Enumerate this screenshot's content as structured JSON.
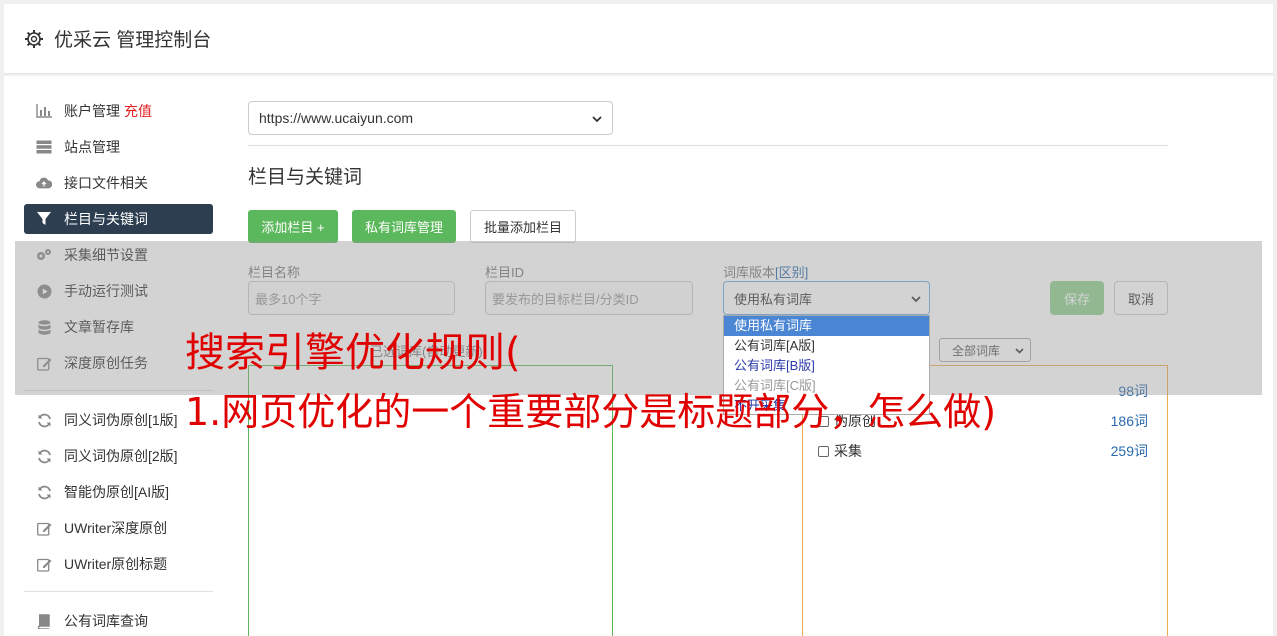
{
  "header": {
    "title": "优采云 管理控制台",
    "icon": "gear-icon"
  },
  "sidebar": {
    "items": [
      {
        "label": "账户管理",
        "icon": "bar-chart-icon",
        "badge": "充值"
      },
      {
        "label": "站点管理",
        "icon": "server-icon"
      },
      {
        "label": "接口文件相关",
        "icon": "cloud-upload-icon"
      },
      {
        "label": "栏目与关键词",
        "icon": "filter-icon",
        "active": true
      },
      {
        "label": "采集细节设置",
        "icon": "cogs-icon"
      },
      {
        "label": "手动运行测试",
        "icon": "play-circle-icon"
      },
      {
        "label": "文章暂存库",
        "icon": "database-icon"
      },
      {
        "label": "深度原创任务",
        "icon": "edit-icon"
      },
      {
        "label": "同义词伪原创[1版]",
        "icon": "refresh-icon"
      },
      {
        "label": "同义词伪原创[2版]",
        "icon": "refresh-icon"
      },
      {
        "label": "智能伪原创[AI版]",
        "icon": "refresh-icon"
      },
      {
        "label": "UWriter深度原创",
        "icon": "edit-icon"
      },
      {
        "label": "UWriter原创标题",
        "icon": "edit-icon"
      },
      {
        "label": "公有词库查询",
        "icon": "book-icon"
      }
    ]
  },
  "main": {
    "site_select": "https://www.ucaiyun.com",
    "section_title": "栏目与关键词",
    "buttons": {
      "add_column": "添加栏目 +",
      "private_lib": "私有词库管理",
      "batch_add": "批量添加栏目"
    },
    "form": {
      "name_label": "栏目名称",
      "name_placeholder": "最多10个字",
      "id_label": "栏目ID",
      "id_placeholder": "要发布的目标栏目/分类ID",
      "version_label": "词库版本",
      "version_link": "[区别]",
      "version_value": "使用私有词库",
      "save": "保存",
      "cancel": "取消"
    },
    "dropdown_options": [
      "使用私有词库",
      "公有词库[A版]",
      "公有词库[B版]",
      "公有词库[C版]",
      "不开采集"
    ],
    "box_caption": "已选词库(自动更新)",
    "lib_filter": "全部词库",
    "libraries": [
      {
        "name": "",
        "count": "98词"
      },
      {
        "name": "伪原创",
        "count": "186词"
      },
      {
        "name": "采集",
        "count": "259词"
      }
    ]
  },
  "headline": {
    "line1": "搜索引擎优化规则(",
    "line2": "1.网页优化的一个重要部分是标题部分，怎么做)"
  }
}
